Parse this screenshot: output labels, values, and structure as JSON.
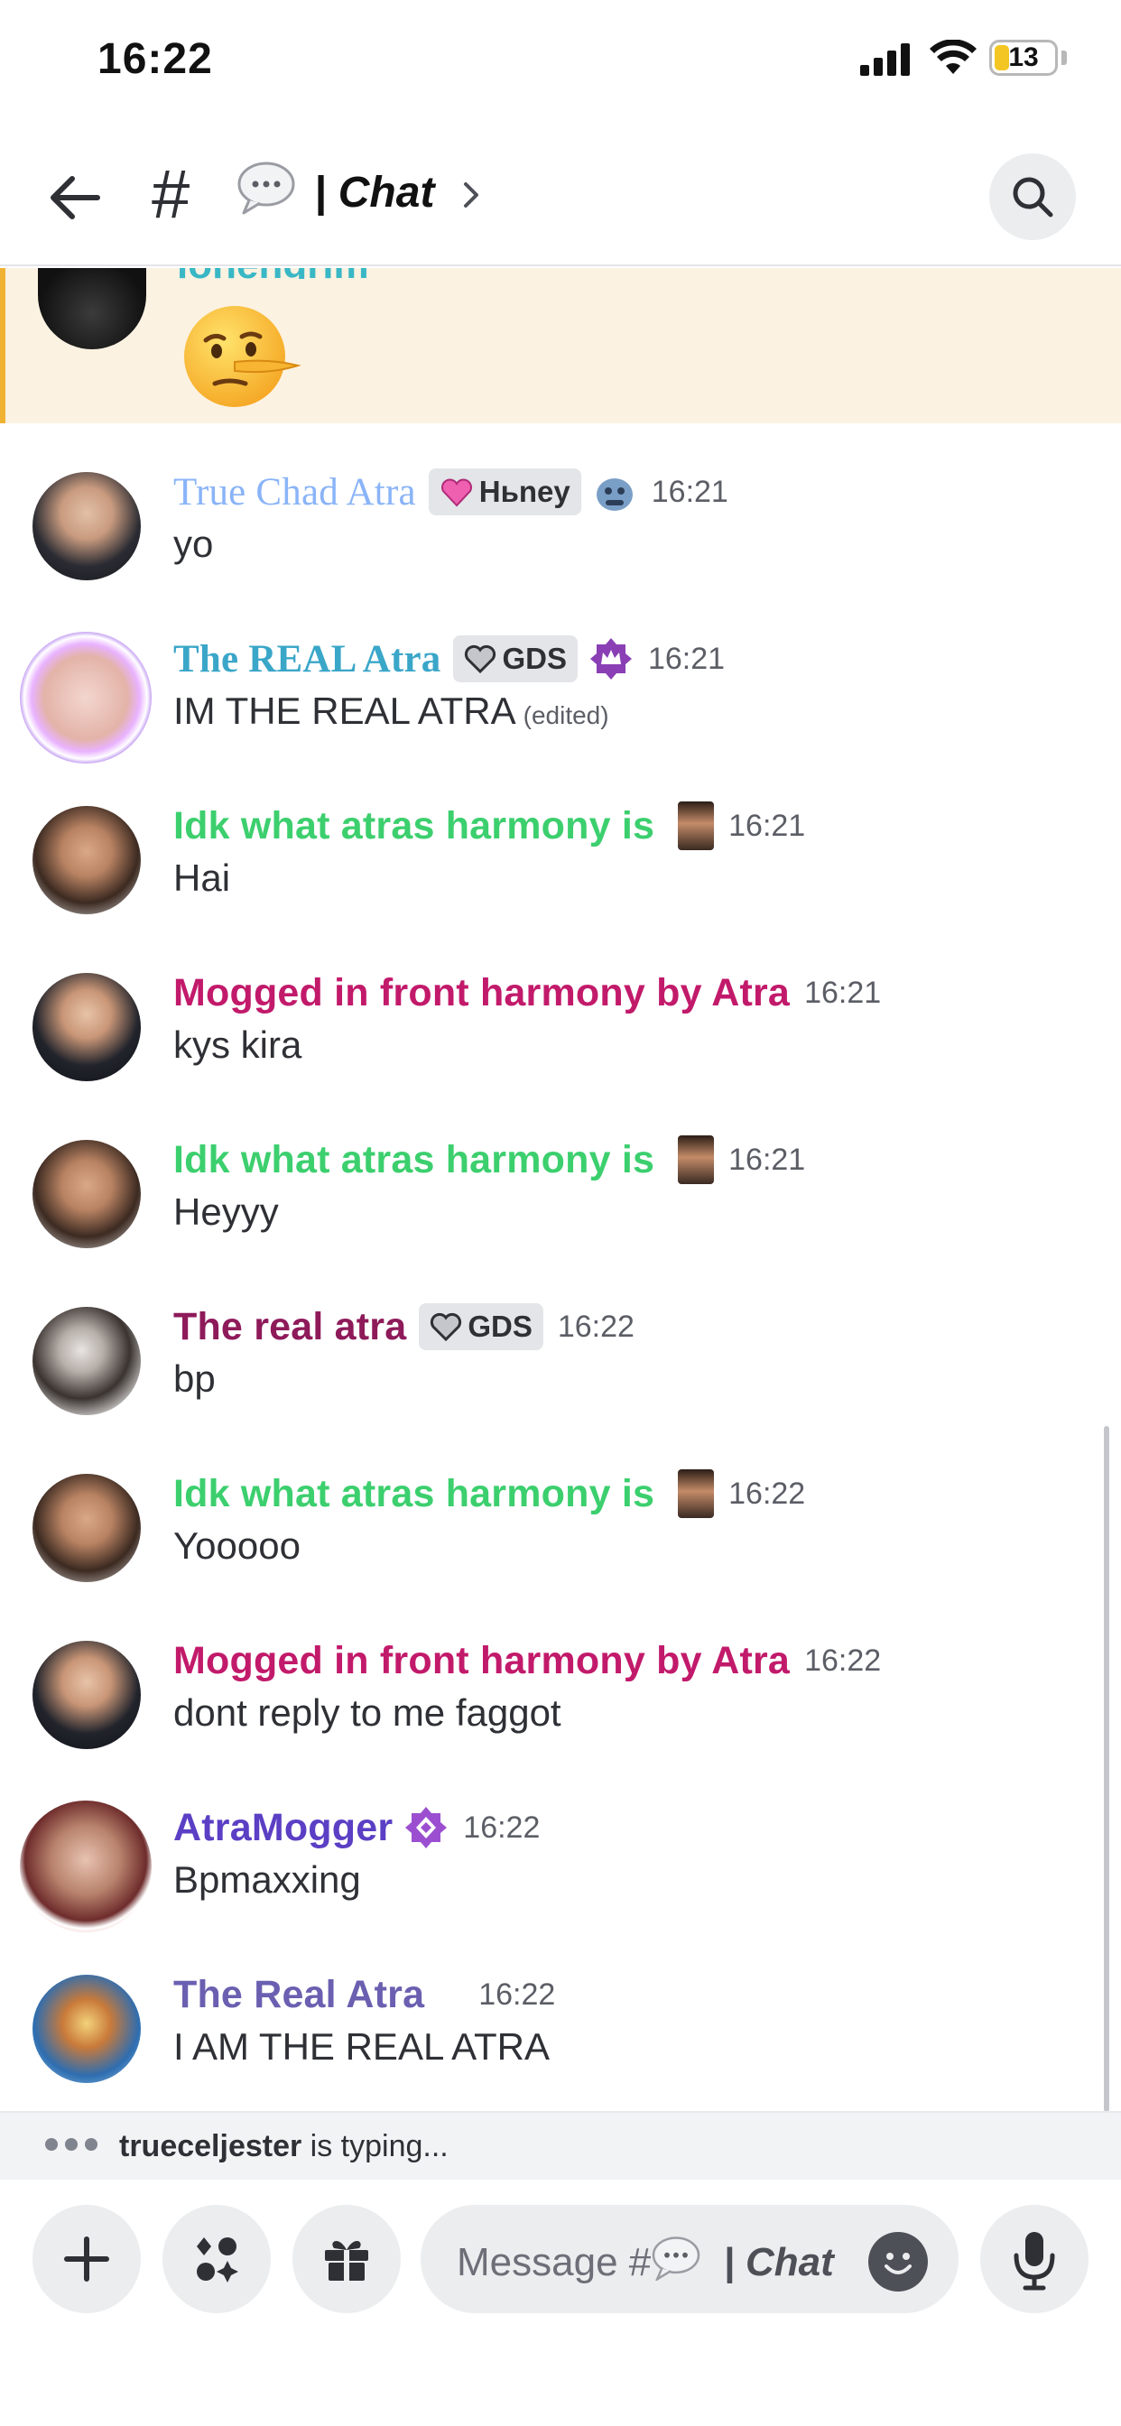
{
  "status_bar": {
    "time": "16:22",
    "battery": "13"
  },
  "header": {
    "hash": "#",
    "title": "| Chat"
  },
  "highlight": {
    "name_partial": "lohengrim",
    "emoji": "lying-face-emoji"
  },
  "messages": [
    {
      "name": "True Chad Atra",
      "tag": "Hьney",
      "time": "16:21",
      "text": "yo",
      "name_color": "#8ab4f8"
    },
    {
      "name": "The REAL Atra",
      "tag": "GDS",
      "time": "16:21",
      "text": "IM THE REAL ATRA",
      "edited": "(edited)",
      "name_color": "#3aa6c8"
    },
    {
      "name": "Idk what atras harmony is",
      "time": "16:21",
      "text": "Hai",
      "name_color": "#3ccf6e"
    },
    {
      "name": "Mogged in front harmony by Atra",
      "time": "16:21",
      "text": "kys kira",
      "name_color": "#c21a6b"
    },
    {
      "name": "Idk what atras harmony is",
      "time": "16:21",
      "text": "Heyyy",
      "name_color": "#3ccf6e"
    },
    {
      "name": "The real atra",
      "tag": "GDS",
      "time": "16:22",
      "text": "bp",
      "name_color": "#8e1a5a"
    },
    {
      "name": "Idk what atras harmony is",
      "time": "16:22",
      "text": "Yooooo",
      "name_color": "#3ccf6e"
    },
    {
      "name": "Mogged in front harmony by Atra",
      "time": "16:22",
      "text": "dont reply to me faggot",
      "name_color": "#c21a6b"
    },
    {
      "name": "AtraMogger",
      "time": "16:22",
      "text": "Bpmaxxing",
      "name_color": "#5b3fc4"
    },
    {
      "name": "The Real Atra",
      "time": "16:22",
      "text": "I AM THE REAL ATRA",
      "name_color": "#6a5fb0"
    }
  ],
  "typing": {
    "user": "trueceljester",
    "suffix": " is typing..."
  },
  "composer": {
    "placeholder_prefix": "Message #",
    "placeholder_channel": "| Chat"
  }
}
